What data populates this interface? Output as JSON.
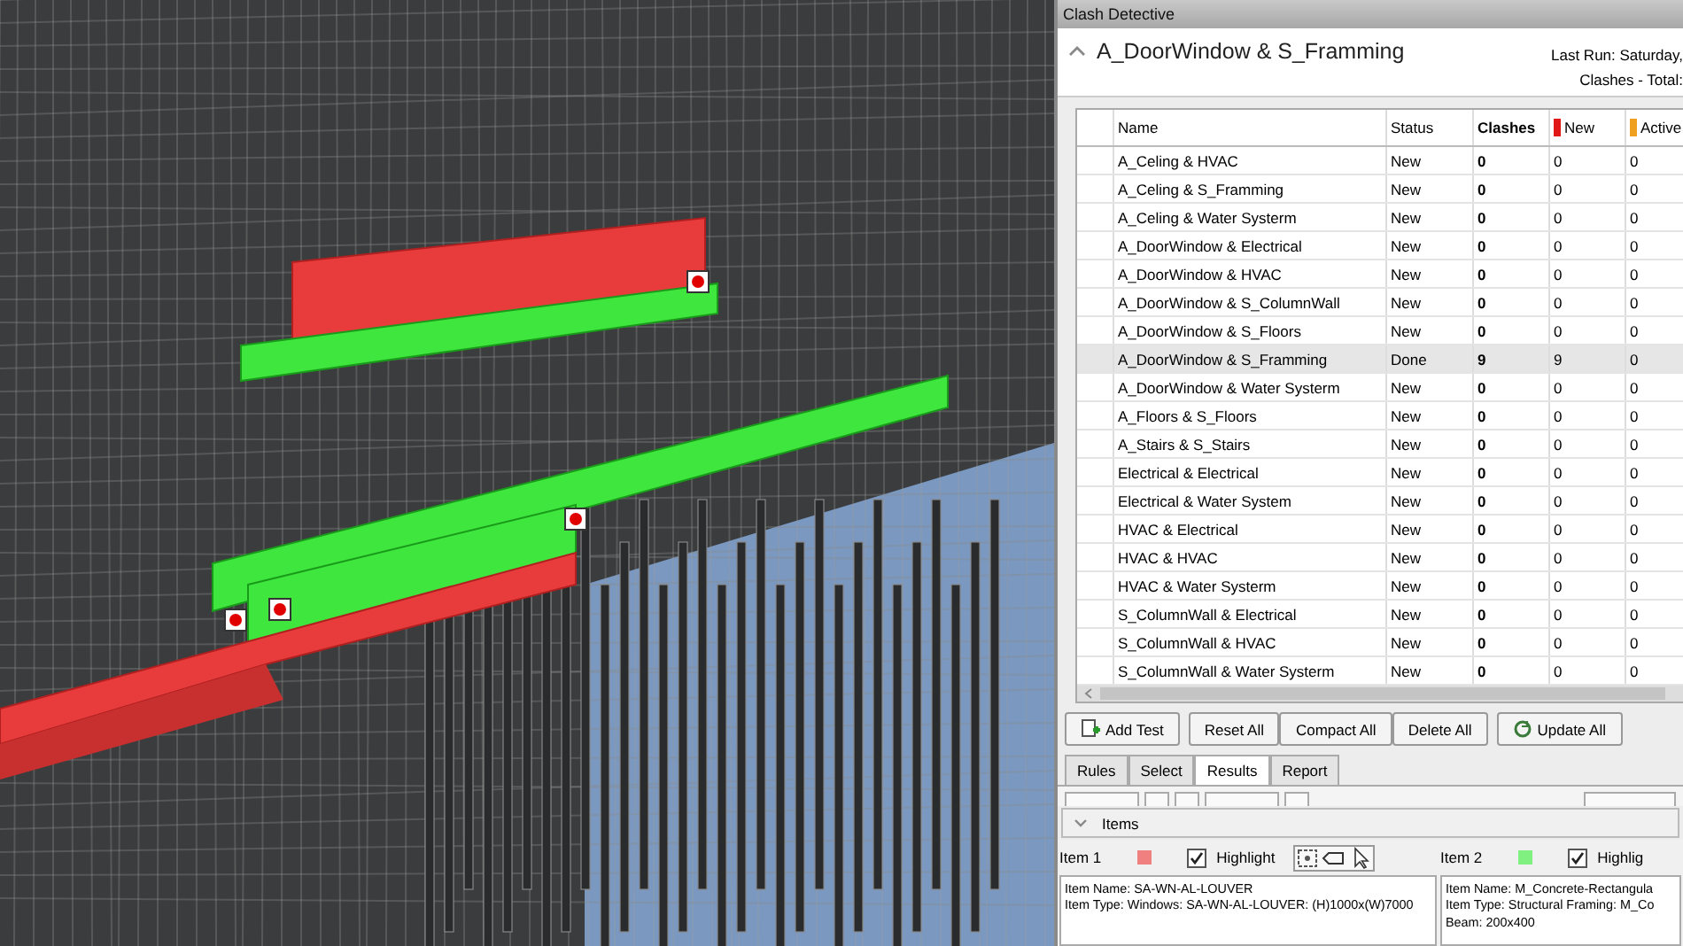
{
  "panel": {
    "title": "Clash Detective",
    "test_name": "A_DoorWindow & S_Framming",
    "last_run": "Last Run:  Saturday,",
    "clashes_total": "Clashes -  Total:"
  },
  "table": {
    "columns": [
      {
        "label": "Name"
      },
      {
        "label": "Status"
      },
      {
        "label": "Clashes"
      },
      {
        "label": "New",
        "color": "#e01818"
      },
      {
        "label": "Active",
        "color": "#f0a020"
      }
    ],
    "rows": [
      {
        "name": "A_Celing & HVAC",
        "status": "New",
        "clashes": "0",
        "new": "0",
        "active": "0",
        "selected": false
      },
      {
        "name": "A_Celing & S_Framming",
        "status": "New",
        "clashes": "0",
        "new": "0",
        "active": "0",
        "selected": false
      },
      {
        "name": "A_Celing & Water Systerm",
        "status": "New",
        "clashes": "0",
        "new": "0",
        "active": "0",
        "selected": false
      },
      {
        "name": "A_DoorWindow & Electrical",
        "status": "New",
        "clashes": "0",
        "new": "0",
        "active": "0",
        "selected": false
      },
      {
        "name": "A_DoorWindow & HVAC",
        "status": "New",
        "clashes": "0",
        "new": "0",
        "active": "0",
        "selected": false
      },
      {
        "name": "A_DoorWindow & S_ColumnWall",
        "status": "New",
        "clashes": "0",
        "new": "0",
        "active": "0",
        "selected": false
      },
      {
        "name": "A_DoorWindow & S_Floors",
        "status": "New",
        "clashes": "0",
        "new": "0",
        "active": "0",
        "selected": false
      },
      {
        "name": "A_DoorWindow & S_Framming",
        "status": "Done",
        "clashes": "9",
        "new": "9",
        "active": "0",
        "selected": true
      },
      {
        "name": "A_DoorWindow & Water Systerm",
        "status": "New",
        "clashes": "0",
        "new": "0",
        "active": "0",
        "selected": false
      },
      {
        "name": "A_Floors & S_Floors",
        "status": "New",
        "clashes": "0",
        "new": "0",
        "active": "0",
        "selected": false
      },
      {
        "name": "A_Stairs & S_Stairs",
        "status": "New",
        "clashes": "0",
        "new": "0",
        "active": "0",
        "selected": false
      },
      {
        "name": "Electrical & Electrical",
        "status": "New",
        "clashes": "0",
        "new": "0",
        "active": "0",
        "selected": false
      },
      {
        "name": "Electrical & Water System",
        "status": "New",
        "clashes": "0",
        "new": "0",
        "active": "0",
        "selected": false
      },
      {
        "name": "HVAC & Electrical",
        "status": "New",
        "clashes": "0",
        "new": "0",
        "active": "0",
        "selected": false
      },
      {
        "name": "HVAC & HVAC",
        "status": "New",
        "clashes": "0",
        "new": "0",
        "active": "0",
        "selected": false
      },
      {
        "name": "HVAC & Water Systerm",
        "status": "New",
        "clashes": "0",
        "new": "0",
        "active": "0",
        "selected": false
      },
      {
        "name": "S_ColumnWall & Electrical",
        "status": "New",
        "clashes": "0",
        "new": "0",
        "active": "0",
        "selected": false
      },
      {
        "name": "S_ColumnWall & HVAC",
        "status": "New",
        "clashes": "0",
        "new": "0",
        "active": "0",
        "selected": false
      },
      {
        "name": "S_ColumnWall & Water Systerm",
        "status": "New",
        "clashes": "0",
        "new": "0",
        "active": "0",
        "selected": false
      }
    ]
  },
  "buttons": [
    {
      "label": "Add Test",
      "kind": "add"
    },
    {
      "label": "Reset All",
      "kind": "plain"
    },
    {
      "label": "Compact All",
      "kind": "plain"
    },
    {
      "label": "Delete All",
      "kind": "plain"
    },
    {
      "label": "Update All",
      "kind": "update"
    }
  ],
  "tabs": [
    {
      "label": "Rules",
      "selected": false
    },
    {
      "label": "Select",
      "selected": false
    },
    {
      "label": "Results",
      "selected": true
    },
    {
      "label": "Report",
      "selected": false
    }
  ],
  "items_section": {
    "title": "Items",
    "items": [
      {
        "label": "Item 1",
        "color": "#f08080",
        "highlight_label": "Highlight",
        "highlight": true,
        "lines": [
          "Item Name: SA-WN-AL-LOUVER",
          "Item Type: Windows: SA-WN-AL-LOUVER: (H)1000x(W)7000"
        ]
      },
      {
        "label": "Item 2",
        "color": "#80f080",
        "highlight_label": "Highlig",
        "highlight": true,
        "lines": [
          "Item Name: M_Concrete-Rectangula",
          "Item Type: Structural Framing: M_Co",
          "Beam: 200x400"
        ]
      }
    ]
  }
}
